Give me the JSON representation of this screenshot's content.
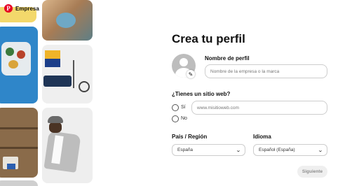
{
  "header": {
    "logo_glyph": "P",
    "brand": "Empresa"
  },
  "form": {
    "title": "Crea tu perfil",
    "profile_name_label": "Nombre de perfil",
    "profile_name_placeholder": "Nombre de la empresa o la marca",
    "website_question": "¿Tienes un sitio web?",
    "website_placeholder": "www.misitioweb.com",
    "radio_yes": "Sí",
    "radio_no": "No",
    "country_label": "País / Región",
    "country_value": "España",
    "language_label": "Idioma",
    "language_value": "Español (España)",
    "next_button": "Siguiente"
  },
  "icons": {
    "logo": "pinterest-logo",
    "edit": "pencil-icon",
    "chevron": "chevron-down-icon",
    "avatar": "user-avatar-icon"
  },
  "colors": {
    "brand_red": "#e60023",
    "border": "#cdcdcd",
    "disabled_button_bg": "#efefef",
    "disabled_button_text": "#8e8e8e"
  }
}
